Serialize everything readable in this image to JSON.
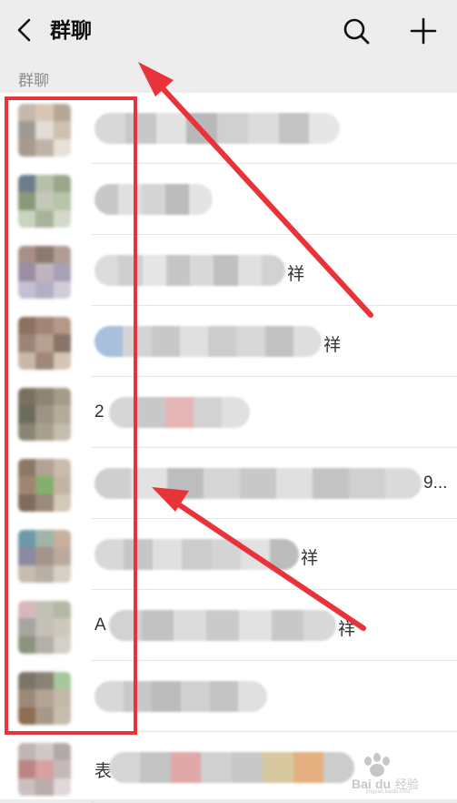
{
  "nav": {
    "title": "群聊"
  },
  "section": {
    "label": "群聊"
  },
  "rows": [
    {
      "name_prefix": "",
      "name_suffix": ""
    },
    {
      "name_prefix": "",
      "name_suffix": ""
    },
    {
      "name_prefix": "",
      "name_suffix": "祥"
    },
    {
      "name_prefix": "",
      "name_suffix": "祥"
    },
    {
      "name_prefix": "2",
      "name_suffix": ""
    },
    {
      "name_prefix": "",
      "name_suffix": "9..."
    },
    {
      "name_prefix": "",
      "name_suffix": "祥"
    },
    {
      "name_prefix": "A",
      "name_suffix": "祥"
    },
    {
      "name_prefix": "",
      "name_suffix": ""
    },
    {
      "name_prefix": "表",
      "name_suffix": ""
    }
  ],
  "watermark": {
    "text": "Baidu经验",
    "url_text": "jingyan.baidu.com"
  },
  "colors": {
    "highlight": "#e8333a",
    "arrow": "#e8333a"
  }
}
